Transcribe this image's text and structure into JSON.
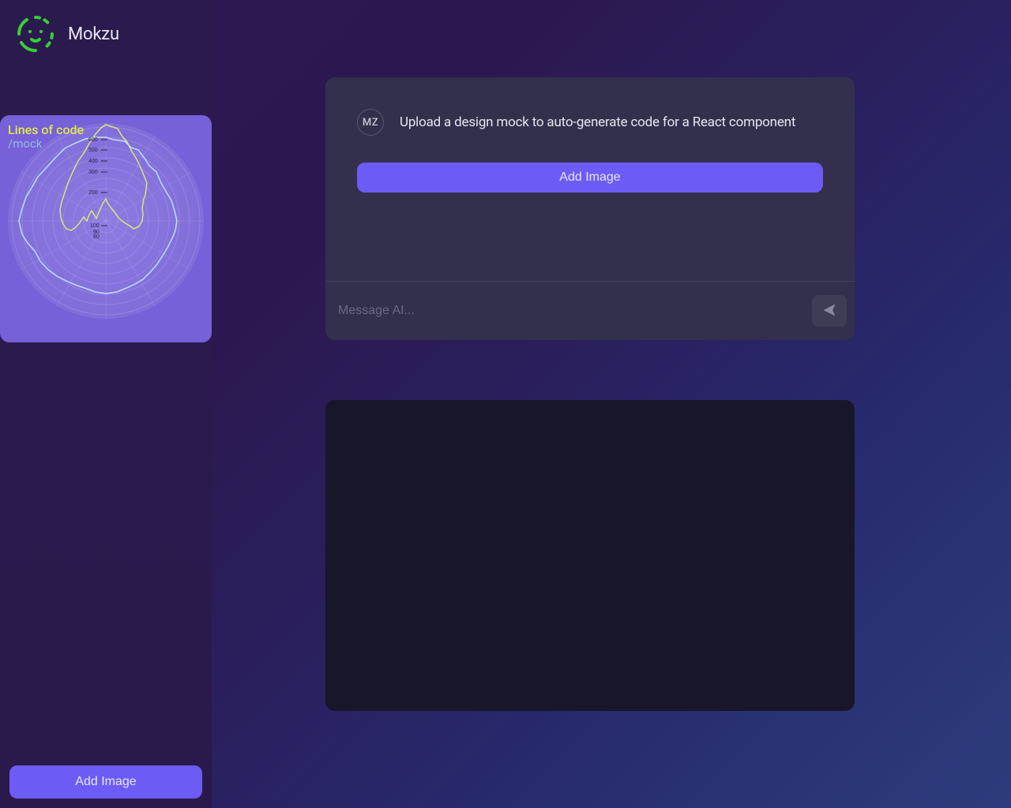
{
  "sidebar": {
    "brand": "Mokzu",
    "chart": {
      "title": "Lines of code",
      "subtitle": "/mock",
      "ticks": [
        "600",
        "500",
        "400",
        "300",
        "200",
        "100",
        "90",
        "80"
      ]
    },
    "add_image_label": "Add Image"
  },
  "main": {
    "avatar_initials": "MZ",
    "upload_text": "Upload a design mock to auto-generate code for a React component",
    "add_image_label": "Add Image",
    "input_placeholder": "Message AI..."
  },
  "colors": {
    "accent": "#6d5bf5",
    "sidebar_card": "#7760d8",
    "panel": "#33304d",
    "dark_panel": "#181629"
  }
}
